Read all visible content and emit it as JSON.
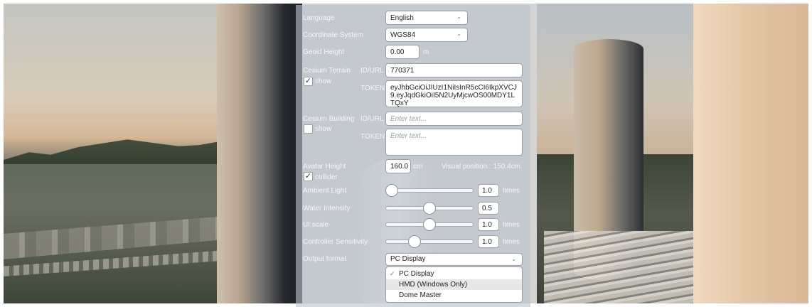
{
  "language": {
    "label": "Language",
    "value": "English"
  },
  "coordinate_system": {
    "label": "Coordinate System",
    "value": "WGS84"
  },
  "geoid_height": {
    "label": "Geoid Height",
    "value": "0.00",
    "unit": "m"
  },
  "cesium_terrain": {
    "label": "Cesium Terrain",
    "show_label": "show",
    "show_checked": true,
    "id_label": "ID/URL",
    "id_value": "770371",
    "token_label": "TOKEN",
    "token_value": "eyJhbGciOiJIUzI1NiIsInR5cCI6IkpXVCJ9.eyJqdGkiOiI5N2UyMjcwOS00MDY1LTQxY"
  },
  "cesium_building": {
    "label": "Cesium Building",
    "show_label": "show",
    "show_checked": false,
    "id_label": "ID/URL",
    "id_placeholder": "Enter text...",
    "token_label": "TOKEN",
    "token_placeholder": "Enter text..."
  },
  "avatar_height": {
    "label": "Avatar Height",
    "value": "160.0",
    "unit": "cm",
    "visual_position": "Visual position : 150.4cm",
    "collider_label": "collider",
    "collider_checked": true
  },
  "ambient_light": {
    "label": "Ambient Light",
    "value": "1.0",
    "unit": "times",
    "slider_fraction": 0.0
  },
  "water_intensity": {
    "label": "Water Intensity",
    "value": "0.5",
    "slider_fraction": 0.5
  },
  "ui_scale": {
    "label": "UI scale",
    "value": "1.0",
    "unit": "times",
    "slider_fraction": 0.5
  },
  "controller_sensitivity": {
    "label": "Controller Sensitivity",
    "value": "1.0",
    "unit": "times",
    "slider_fraction": 0.3
  },
  "output_format": {
    "label": "Output format",
    "value": "PC Display",
    "options": [
      {
        "label": "PC Display",
        "selected": true
      },
      {
        "label": "HMD (Windows Only)",
        "selected": false
      },
      {
        "label": "Dome Master",
        "selected": false
      }
    ]
  },
  "icons": {
    "chevron": "chevron-down-icon",
    "check": "check-icon"
  },
  "colors": {
    "panel": "#bac0cc",
    "label_text": "#f4f6fa"
  }
}
